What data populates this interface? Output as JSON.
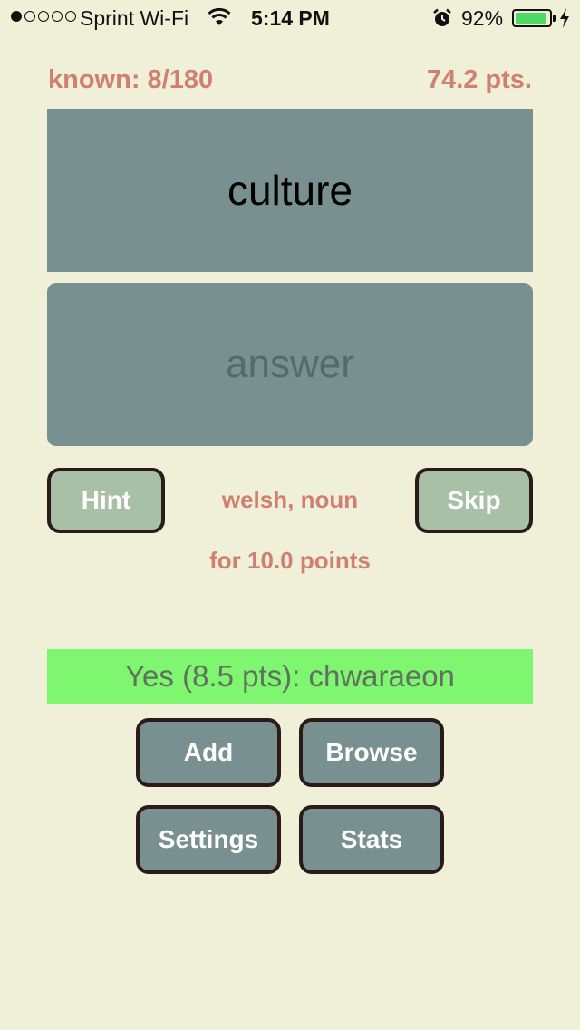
{
  "status_bar": {
    "carrier": "Sprint Wi-Fi",
    "time": "5:14 PM",
    "battery_percent": "92%",
    "battery_level": 0.92,
    "icons": [
      "signal-dots-icon",
      "wifi-icon",
      "alarm-icon",
      "battery-icon",
      "charging-bolt-icon"
    ]
  },
  "stats": {
    "known": "known: 8/180",
    "points": "74.2 pts."
  },
  "card": {
    "word": "culture"
  },
  "answer": {
    "placeholder": "answer",
    "value": ""
  },
  "controls": {
    "hint_label": "Hint",
    "skip_label": "Skip",
    "language_pos": "welsh, noun",
    "worth": "for 10.0 points"
  },
  "result": {
    "text": "Yes (8.5 pts): chwaraeon"
  },
  "menu": {
    "add_label": "Add",
    "browse_label": "Browse",
    "settings_label": "Settings",
    "stats_label": "Stats"
  },
  "colors": {
    "background": "#f0efd7",
    "card": "#789090",
    "accent_text": "#d08073",
    "small_button": "#a7c0a6",
    "success": "#7ef66f",
    "button_border": "#2a1a1a"
  }
}
